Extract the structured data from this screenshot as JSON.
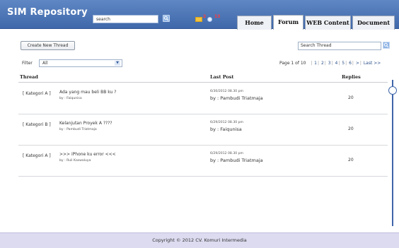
{
  "header": {
    "logo": "SIM Repository",
    "search_value": "search",
    "mail_count": "2",
    "notif_count": "13",
    "tabs": [
      "Home",
      "Forum",
      "WEB Content",
      "Document"
    ],
    "active_tab": "Forum"
  },
  "toolbar": {
    "create_label": "Create New Thread",
    "search_thread_placeholder": "Search Thread"
  },
  "filter": {
    "label": "Filter",
    "selected": "All"
  },
  "pager": {
    "text": "Page 1 of 10",
    "pages": [
      "1",
      "2",
      "3",
      "4",
      "5",
      "6"
    ],
    "next": ">",
    "last": "Last >>"
  },
  "table": {
    "headers": {
      "thread": "Thread",
      "last_post": "Last Post",
      "replies": "Replies"
    },
    "rows": [
      {
        "category": "[ Kategori A ]",
        "title": "Ada yang mau beli BB ku ?",
        "by": "by : Faiqunisa",
        "last_date": "6/30/2012 08.30 pm",
        "last_by": "by : Pambudi Triatmaja",
        "replies": "20"
      },
      {
        "category": "[ Kategori B ]",
        "title": "Kelanjutan Proyek A ????",
        "by": "by : Pambudi Triatmaja",
        "last_date": "6/29/2012 08.30 pm",
        "last_by": "by : Faiqunisa",
        "replies": "20"
      },
      {
        "category": "[ Kategori A ]",
        "title": ">>> iPhone ku error <<<",
        "by": "by : Ruli Kaswaluya",
        "last_date": "6/29/2012 08.30 pm",
        "last_by": "by : Pambudi Triatmaja",
        "replies": "20"
      }
    ]
  },
  "footer": {
    "copyright": "Copyright © 2012 CV. Komuri Intermedia"
  },
  "colors": {
    "header_bg": "#4a74b8",
    "footer_bg": "#dcdbf0",
    "accent": "#3e65a9"
  },
  "icons": {
    "search": "search-icon",
    "mail": "mail-icon",
    "notification": "notification-icon"
  }
}
